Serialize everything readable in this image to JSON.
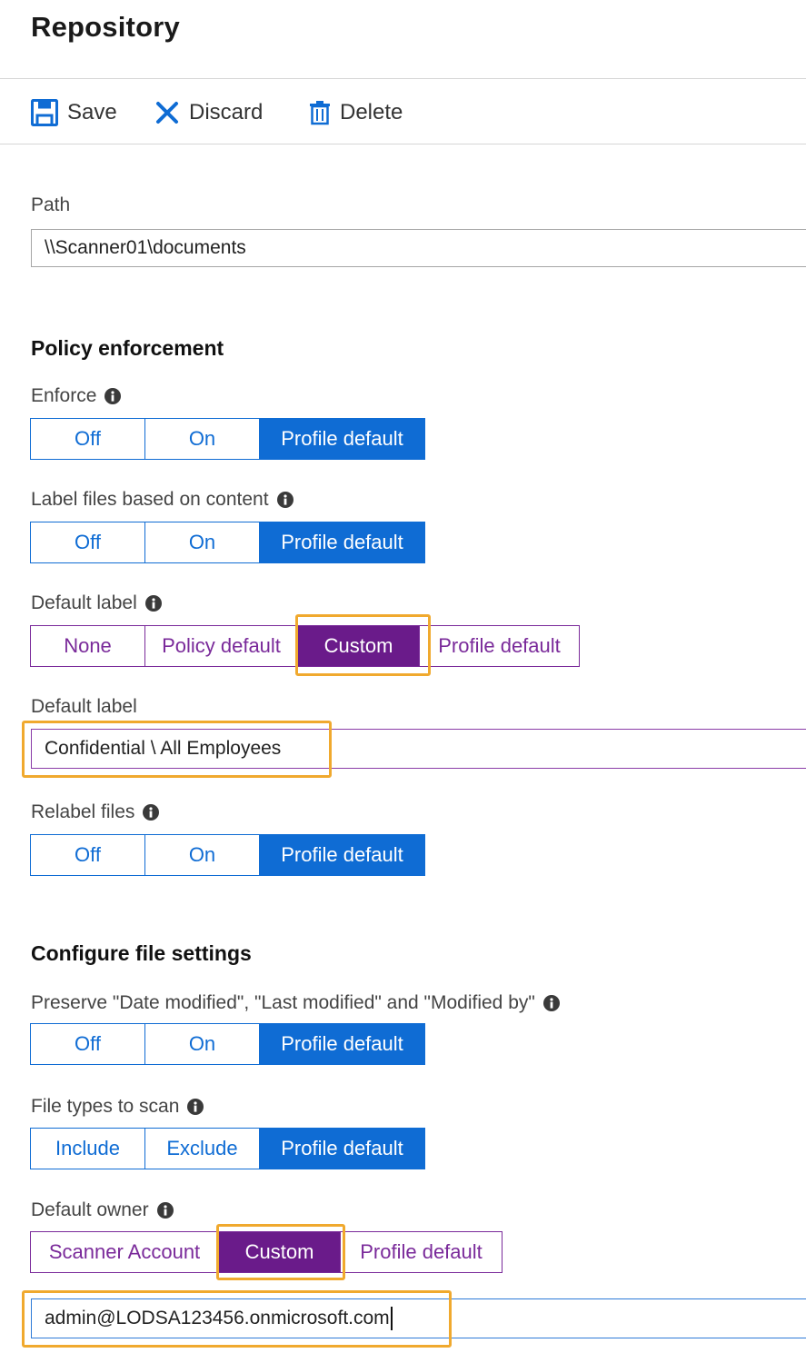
{
  "page": {
    "title": "Repository"
  },
  "toolbar": {
    "save": "Save",
    "discard": "Discard",
    "delete": "Delete"
  },
  "path": {
    "label": "Path",
    "value": "\\\\Scanner01\\documents"
  },
  "policy": {
    "heading": "Policy enforcement",
    "enforce": {
      "label": "Enforce",
      "options": [
        "Off",
        "On",
        "Profile default"
      ],
      "selected": "Profile default"
    },
    "label_files": {
      "label": "Label files based on content",
      "options": [
        "Off",
        "On",
        "Profile default"
      ],
      "selected": "Profile default"
    },
    "default_label_mode": {
      "label": "Default label",
      "options": [
        "None",
        "Policy default",
        "Custom",
        "Profile default"
      ],
      "selected": "Custom"
    },
    "default_label_value": {
      "label": "Default label",
      "value": "Confidential \\ All Employees"
    },
    "relabel": {
      "label": "Relabel files",
      "options": [
        "Off",
        "On",
        "Profile default"
      ],
      "selected": "Profile default"
    }
  },
  "file_settings": {
    "heading": "Configure file settings",
    "preserve": {
      "label": "Preserve \"Date modified\", \"Last modified\" and \"Modified by\"",
      "options": [
        "Off",
        "On",
        "Profile default"
      ],
      "selected": "Profile default"
    },
    "file_types": {
      "label": "File types to scan",
      "options": [
        "Include",
        "Exclude",
        "Profile default"
      ],
      "selected": "Profile default"
    },
    "default_owner": {
      "label": "Default owner",
      "options": [
        "Scanner Account",
        "Custom",
        "Profile default"
      ],
      "selected": "Custom"
    },
    "owner_value": "admin@LODSA123456.onmicrosoft.com"
  },
  "colors": {
    "accent_blue": "#0f6cd4",
    "accent_purple": "#6a1b8a",
    "highlight": "#f0a92e"
  },
  "icons": {
    "save": "save-icon",
    "discard": "close-icon",
    "delete": "trash-icon",
    "info": "info-icon"
  }
}
